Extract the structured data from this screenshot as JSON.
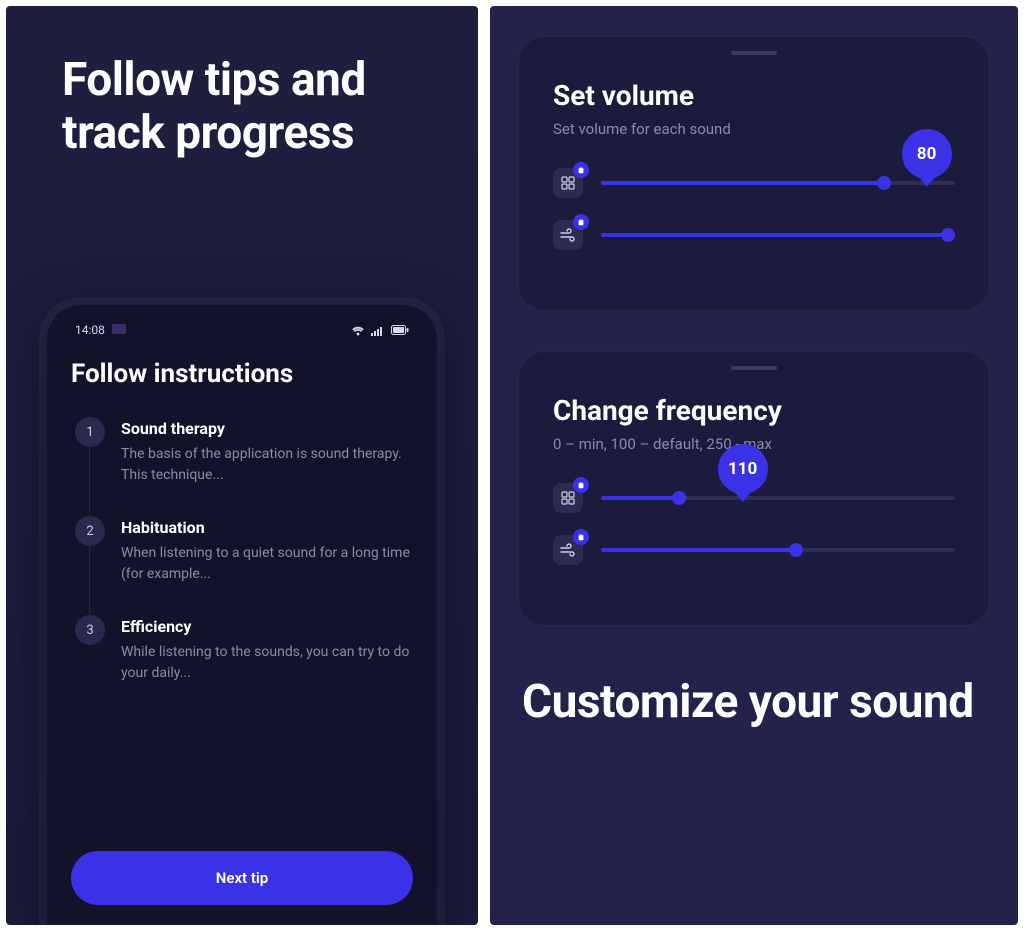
{
  "left": {
    "heading": "Follow tips and track progress",
    "status_time": "14:08",
    "phone_title": "Follow instructions",
    "steps": [
      {
        "num": "1",
        "title": "Sound therapy",
        "desc": "The basis of the application is sound therapy. This technique..."
      },
      {
        "num": "2",
        "title": "Habituation",
        "desc": "When listening to a quiet sound for a long time (for example..."
      },
      {
        "num": "3",
        "title": "Efficiency",
        "desc": "While listening to the sounds, you can try to do your daily..."
      }
    ],
    "next_btn": "Next tip"
  },
  "right": {
    "card1": {
      "title": "Set volume",
      "sub": "Set volume for each sound",
      "pin": "80"
    },
    "card2": {
      "title": "Change frequency",
      "sub": "0 – min, 100 – default, 250 - max",
      "pin": "110"
    },
    "heading": "Customize your sound"
  }
}
